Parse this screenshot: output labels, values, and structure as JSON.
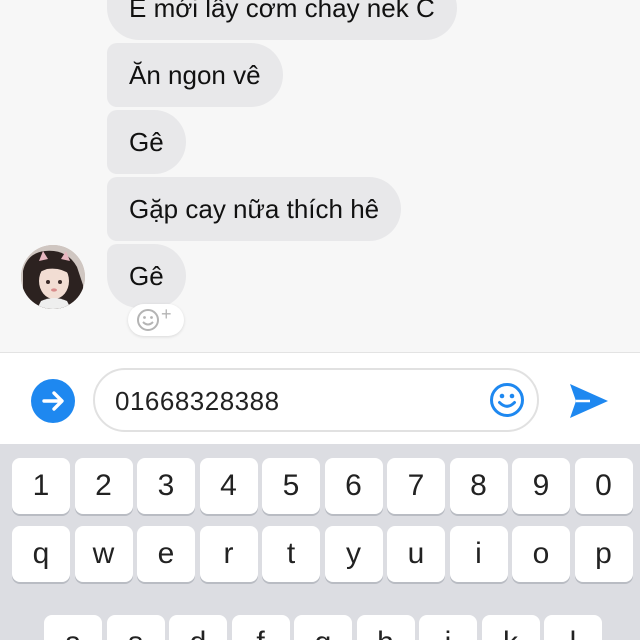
{
  "messages": [
    {
      "text": "E mới lấy cơm chay nek C"
    },
    {
      "text": "Ăn ngon vê"
    },
    {
      "text": "Gê"
    },
    {
      "text": "Gặp cay nữa thích hê"
    },
    {
      "text": "Gê"
    }
  ],
  "reaction": {
    "icon": "add-reaction-icon",
    "plus": "+"
  },
  "composer": {
    "expand_icon": "arrow-right-circle-icon",
    "value": "01668328388",
    "emoji_icon": "smiley-icon",
    "send_icon": "send-icon"
  },
  "keyboard": {
    "number_row": [
      "1",
      "2",
      "3",
      "4",
      "5",
      "6",
      "7",
      "8",
      "9",
      "0"
    ],
    "letter_row_1": [
      "q",
      "w",
      "e",
      "r",
      "t",
      "y",
      "u",
      "i",
      "o",
      "p"
    ],
    "letter_row_2": [
      "a",
      "s",
      "d",
      "f",
      "g",
      "h",
      "j",
      "k",
      "l"
    ]
  },
  "colors": {
    "accent": "#1e88f0",
    "bubble": "#e8e8ea",
    "chat_bg": "#f7f7f7",
    "keyboard_bg": "#dcdde2"
  }
}
